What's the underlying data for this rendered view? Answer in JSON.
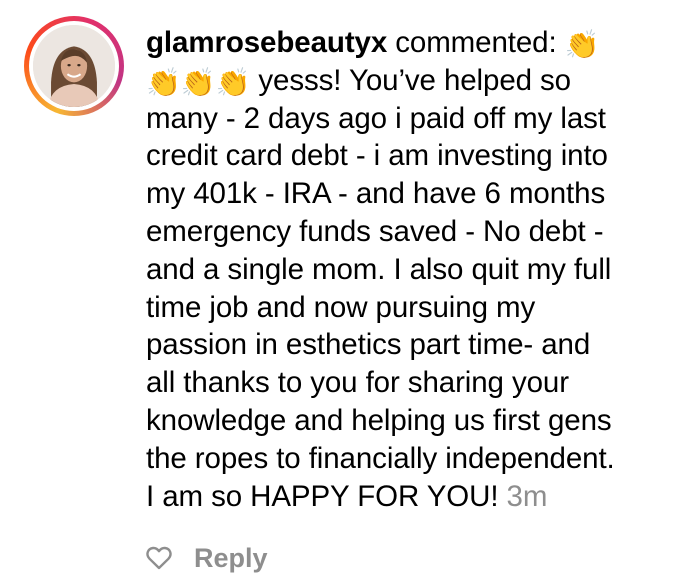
{
  "comment": {
    "username": "glamrosebeautyx",
    "action_text": " commented: ",
    "clap_emoji": "👏",
    "text_after_emojis": " yesss! You’ve helped so\nmany - 2 days ago i paid off my last\ncredit card debt - i am investing into\nmy 401k - IRA - and have 6 months\nemergency funds saved - No debt -\nand a single mom. I also quit my full\ntime job and now pursuing my\npassion in esthetics part time- and\nall thanks to you for sharing your\nknowledge and helping us first gens\nthe ropes to financially independent.\nI am so HAPPY FOR YOU!",
    "timestamp": " 3m"
  },
  "actions": {
    "reply_label": "Reply",
    "like_icon": "heart-outline-icon"
  },
  "colors": {
    "text": "#000000",
    "muted": "#8e8e8e",
    "story_ring": [
      "#f7b733",
      "#fc4a1a",
      "#e1306c",
      "#c13584"
    ]
  }
}
